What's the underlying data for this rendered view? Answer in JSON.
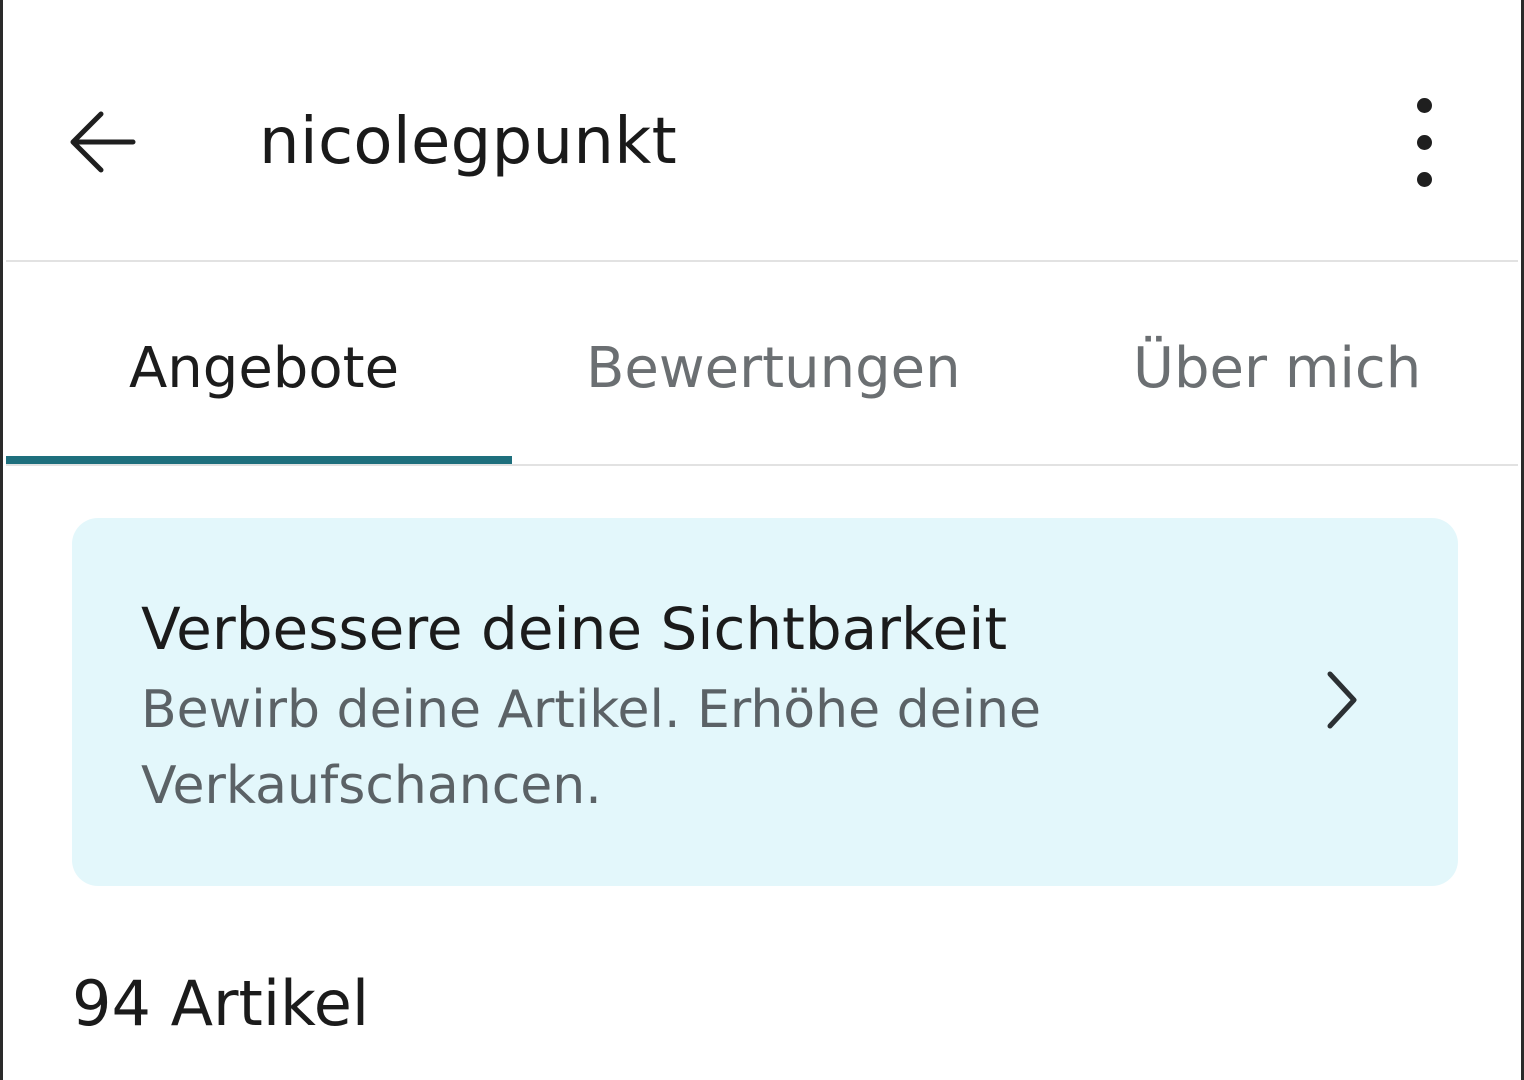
{
  "header": {
    "back_icon": "arrow-left-icon",
    "title": "nicolegpunkt",
    "more_icon": "more-vertical-icon"
  },
  "tabs": [
    {
      "label": "Angebote",
      "active": true
    },
    {
      "label": "Bewertungen",
      "active": false
    },
    {
      "label": "Über mich",
      "active": false
    }
  ],
  "promo": {
    "title": "Verbessere deine Sichtbarkeit",
    "text": "Bewirb deine Artikel. Erhöhe deine Verkaufschancen.",
    "chevron_icon": "chevron-right-icon"
  },
  "listing": {
    "count_label": "94 Artikel"
  },
  "colors": {
    "accent": "#1e6f7d",
    "promo_background": "#e3f7fb",
    "inactive_tab": "#6b6f72"
  }
}
